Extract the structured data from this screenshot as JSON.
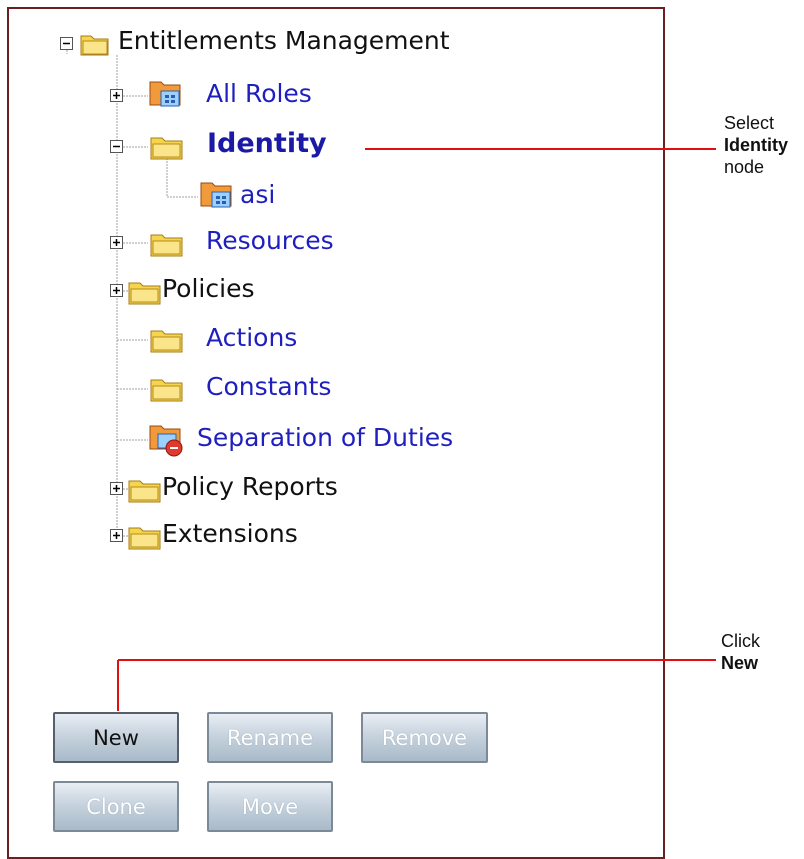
{
  "tree": {
    "root": {
      "label": "Entitlements Management",
      "icon": "folder-open-icon"
    },
    "nodes": [
      {
        "label": "All Roles",
        "icon": "role-folder-icon"
      },
      {
        "label": "Identity",
        "icon": "folder-icon"
      },
      {
        "label": "asi",
        "icon": "role-folder-icon"
      },
      {
        "label": "Resources",
        "icon": "folder-icon"
      },
      {
        "label": "Policies",
        "icon": "folder-icon"
      },
      {
        "label": "Actions",
        "icon": "folder-icon"
      },
      {
        "label": "Constants",
        "icon": "folder-icon"
      },
      {
        "label": "Separation of Duties",
        "icon": "sod-folder-icon"
      },
      {
        "label": "Policy Reports",
        "icon": "folder-icon"
      },
      {
        "label": "Extensions",
        "icon": "folder-icon"
      }
    ]
  },
  "buttons": {
    "new": "New",
    "rename": "Rename",
    "remove": "Remove",
    "clone": "Clone",
    "move": "Move"
  },
  "callouts": {
    "identity": {
      "line1": "Select",
      "line2": "Identity",
      "line3": "node"
    },
    "new": {
      "line1": "Click",
      "line2": "New"
    }
  },
  "colors": {
    "panel_border": "#6b1f1f",
    "link_blue": "#1f1fbf",
    "callout_red": "#e01010",
    "folder_yellow": "#f5d44a"
  }
}
